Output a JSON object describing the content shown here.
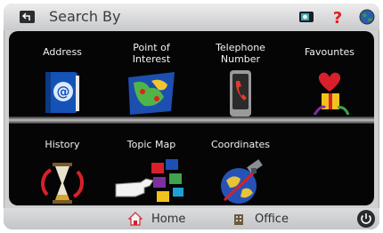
{
  "header": {
    "title": "Search By"
  },
  "categories": [
    {
      "id": "address",
      "label": "Address",
      "icon": "address-book-icon"
    },
    {
      "id": "poi",
      "label": "Point of\nInterest",
      "icon": "poi-map-icon"
    },
    {
      "id": "telephone",
      "label": "Telephone\nNumber",
      "icon": "phone-icon"
    },
    {
      "id": "favourites",
      "label": "Favountes",
      "icon": "heart-gift-icon"
    },
    {
      "id": "history",
      "label": "History",
      "icon": "hourglass-icon"
    },
    {
      "id": "topic-map",
      "label": "Topic Map",
      "icon": "topic-cubes-icon"
    },
    {
      "id": "coordinates",
      "label": "Coordinates",
      "icon": "satellite-globe-icon"
    }
  ],
  "footer": {
    "home_label": "Home",
    "office_label": "Office"
  },
  "colors": {
    "panel": "#050505",
    "accent_red": "#e02020"
  }
}
